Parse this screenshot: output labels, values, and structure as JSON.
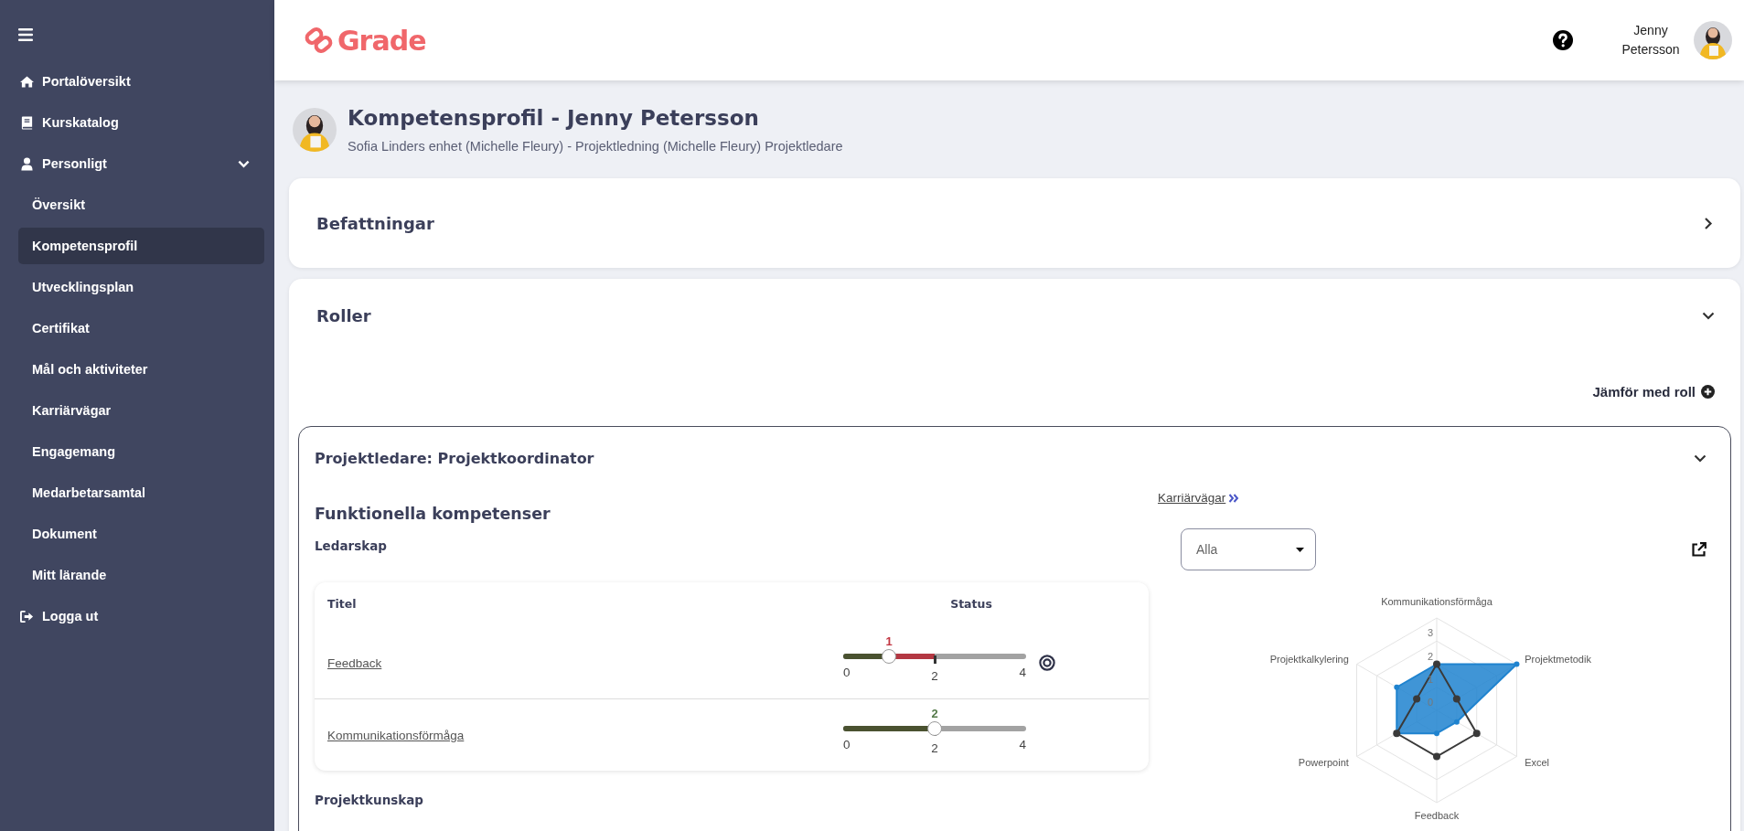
{
  "sidebar": {
    "items": [
      {
        "label": "Portalöversikt",
        "selected": false
      },
      {
        "label": "Kurskatalog",
        "selected": false
      },
      {
        "label": "Personligt",
        "selected": false,
        "expanded": true,
        "children": [
          {
            "label": "Översikt",
            "selected": false
          },
          {
            "label": "Kompetensprofil",
            "selected": true
          },
          {
            "label": "Utvecklingsplan",
            "selected": false
          },
          {
            "label": "Certifikat",
            "selected": false
          },
          {
            "label": "Mål och aktiviteter",
            "selected": false
          },
          {
            "label": "Karriärvägar",
            "selected": false
          },
          {
            "label": "Engagemang",
            "selected": false
          },
          {
            "label": "Medarbetarsamtal",
            "selected": false
          },
          {
            "label": "Dokument",
            "selected": false
          },
          {
            "label": "Mitt lärande",
            "selected": false
          }
        ]
      },
      {
        "label": "Logga ut",
        "selected": false
      }
    ]
  },
  "header": {
    "logo": "Grade",
    "user_name": "Jenny Petersson"
  },
  "page": {
    "title": "Kompetensprofil - Jenny Petersson",
    "subtitle": "Sofia Linders enhet (Michelle Fleury) - Projektledning (Michelle Fleury) Projektledare"
  },
  "positions": {
    "title": "Befattningar",
    "expanded": false
  },
  "roles": {
    "title": "Roller",
    "expanded": true,
    "compare_link": "Jämför med roll",
    "role": {
      "title": "Projektledare: Projektkoordinator",
      "expanded": true,
      "section_title": "Funktionella kompetenser",
      "groups": [
        {
          "title": "Ledarskap",
          "table": {
            "columns": [
              "Titel",
              "Status"
            ],
            "rows": [
              {
                "title": "Feedback",
                "value": {
                  "label": "1",
                  "level": 0.25
                },
                "target": {
                  "label": "2",
                  "level": 0.5
                },
                "min": "0",
                "max": "4",
                "below_target": true,
                "goal_icon": true
              },
              {
                "title": "Kommunikationsförmåga",
                "value": {
                  "label": "2",
                  "level": 0.5
                },
                "target": {
                  "label": "2",
                  "level": 0.5
                },
                "min": "0",
                "max": "4",
                "below_target": false,
                "goal_icon": false
              }
            ]
          }
        },
        {
          "title": "Projektkunskap"
        }
      ],
      "career_link": "Karriärvägar",
      "filter": {
        "value": "Alla"
      },
      "chart_data": {
        "type": "radar",
        "categories": [
          "Kommunikationsförmåga",
          "Projektmetodik",
          "Excel",
          "Feedback",
          "Powerpoint",
          "Projektkalkylering"
        ],
        "ylim": [
          0,
          4
        ],
        "yticks": [
          0,
          1,
          2,
          3
        ],
        "series": [
          {
            "color": "#1f83cf",
            "values": [
              2,
              4,
              1,
              1,
              2,
              2
            ]
          },
          {
            "color": "#3a3a3a",
            "values": [
              2,
              1,
              2,
              2,
              2,
              1
            ]
          }
        ]
      }
    }
  }
}
